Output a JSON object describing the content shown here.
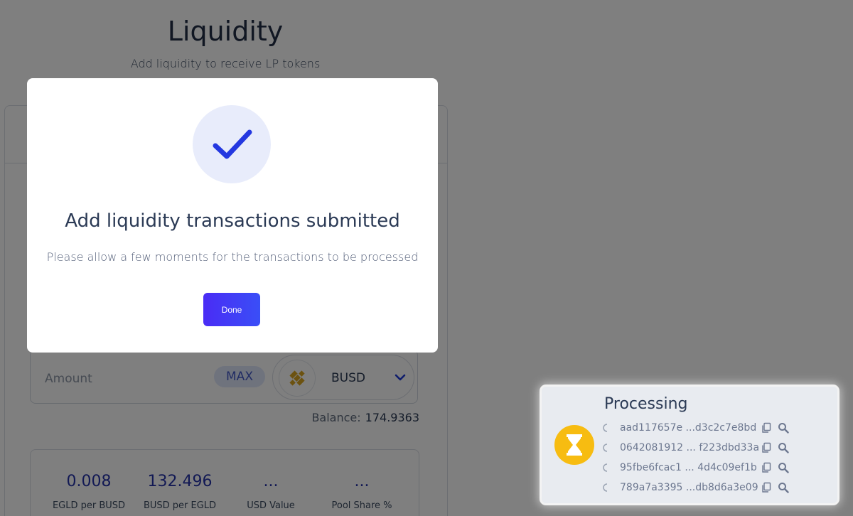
{
  "page": {
    "title": "Liquidity",
    "subtitle": "Add liquidity to receive LP tokens"
  },
  "amount_input": {
    "placeholder": "Amount",
    "max_label": "MAX",
    "token": "BUSD"
  },
  "balance": {
    "label": "Balance:",
    "value": "174.9363"
  },
  "stats": [
    {
      "value": "0.008",
      "label": "EGLD per BUSD"
    },
    {
      "value": "132.496",
      "label": "BUSD per EGLD"
    },
    {
      "value": "...",
      "label": "USD Value"
    },
    {
      "value": "...",
      "label": "Pool Share %"
    }
  ],
  "modal": {
    "title": "Add liquidity transactions submitted",
    "text": "Please allow a few moments for the transactions to be processed",
    "done_label": "Done",
    "icon": "checkmark-icon"
  },
  "toast": {
    "title": "Processing",
    "icon": "hourglass-icon",
    "transactions": [
      {
        "hash": "aad117657e ...d3c2c7e8bd"
      },
      {
        "hash": "0642081912 ... f223dbd33a"
      },
      {
        "hash": "95fbe6fcac1 ... 4d4c09ef1b"
      },
      {
        "hash": "789a7a3395 ...db8d6a3e09"
      }
    ]
  },
  "colors": {
    "accent": "#3a3ff5",
    "check": "#2438e0",
    "toast_icon": "#f7bc11",
    "stat_value": "#2532a8"
  }
}
